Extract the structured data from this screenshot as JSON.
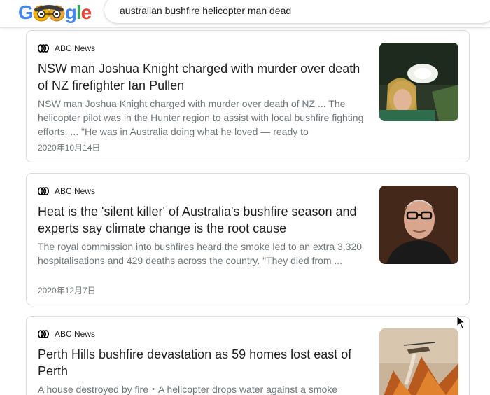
{
  "header": {
    "logo_letters": [
      "G",
      "g",
      "l",
      "e"
    ],
    "logo_icon": "doodle-face-icon",
    "search_query": "australian bushfire helicopter man dead"
  },
  "results": [
    {
      "source": "ABC News",
      "source_icon": "abc-news-logo-icon",
      "title": "NSW man Joshua Knight charged with murder over death of NZ firefighter Ian Pullen",
      "snippet": "NSW man Joshua Knight charged with murder over death of NZ ... The helicopter pilot was in the Hunter region to assist with local bushfire fighting efforts. ... \"He was in Australia doing what he loved — ready to",
      "date": "2020年10月14日",
      "thumbnail": "woman-in-helicopter-photo"
    },
    {
      "source": "ABC News",
      "source_icon": "abc-news-logo-icon",
      "title": "Heat is the 'silent killer' of Australia's bushfire season and experts say climate change is the root cause",
      "snippet": "The royal commission into bushfires heard the smoke led to an extra 3,320 hospitalisations and 429 deaths across the country. \"They died from ...",
      "date": "2020年12月7日",
      "thumbnail": "man-with-glasses-photo"
    },
    {
      "source": "ABC News",
      "source_icon": "abc-news-logo-icon",
      "title": "Perth Hills bushfire devastation as 59 homes lost east of Perth",
      "snippet": "A house destroyed by fire・A helicopter drops water against a smoke",
      "date": "",
      "thumbnail": "helicopter-over-bushfire-photo"
    }
  ],
  "colors": {
    "title": "#1f1f1f",
    "snippet": "#70757a",
    "border": "#dadce0"
  }
}
